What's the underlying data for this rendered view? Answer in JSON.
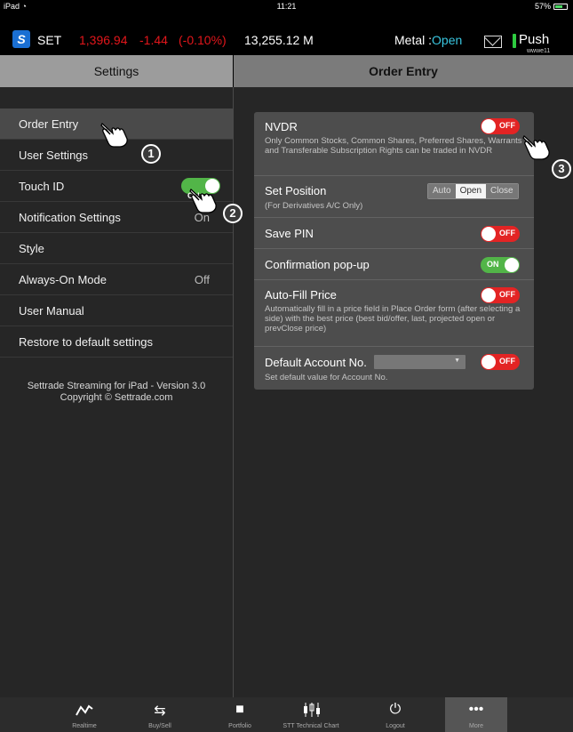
{
  "status": {
    "device": "iPad",
    "time": "11:21",
    "battery": "57%"
  },
  "ticker": {
    "index_name": "SET",
    "index_value": "1,396.94",
    "change": "-1.44",
    "change_pct": "(-0.10%)",
    "volume": "13,255.12 M",
    "market_label": "Metal :",
    "market_status": "Open",
    "push_label": "Push",
    "push_user": "wwwe11",
    "colors": {
      "negative": "#e3161b",
      "open": "#39c6e0"
    }
  },
  "headers": {
    "left": "Settings",
    "right": "Order Entry"
  },
  "sidebar": {
    "items": [
      {
        "label": "Order Entry",
        "value": ""
      },
      {
        "label": "User Settings",
        "value": ""
      },
      {
        "label": "Touch ID",
        "value": ""
      },
      {
        "label": "Notification Settings",
        "value": "On"
      },
      {
        "label": "Style",
        "value": ""
      },
      {
        "label": "Always-On Mode",
        "value": "Off"
      },
      {
        "label": "User Manual",
        "value": ""
      },
      {
        "label": "Restore to default settings",
        "value": ""
      }
    ],
    "touch_id_toggle": "ON",
    "version_line1": "Settrade Streaming for iPad - Version 3.0",
    "version_line2": "Copyright © Settrade.com"
  },
  "order_entry": {
    "nvdr": {
      "title": "NVDR",
      "desc": "Only Common Stocks, Common Shares, Preferred Shares, Warrants and Transferable Subscription Rights can be traded in NVDR",
      "toggle": "OFF"
    },
    "set_position": {
      "title": "Set Position",
      "desc": "(For Derivatives A/C Only)",
      "options": [
        "Auto",
        "Open",
        "Close"
      ],
      "selected": "Open"
    },
    "save_pin": {
      "title": "Save PIN",
      "toggle": "OFF"
    },
    "confirmation": {
      "title": "Confirmation pop-up",
      "toggle": "ON"
    },
    "auto_fill": {
      "title": "Auto-Fill Price",
      "desc": "Automatically fill in a price field in Place Order form (after selecting a side) with the best price (best bid/offer, last, projected open or prevClose price)",
      "toggle": "OFF"
    },
    "default_account": {
      "title": "Default Account No.",
      "desc": "Set default value for Account No.",
      "dropdown_value": "",
      "toggle": "OFF"
    }
  },
  "callouts": [
    "1",
    "2",
    "3"
  ],
  "tabs": [
    {
      "label": "Realtime",
      "icon": "realtime-chart-icon"
    },
    {
      "label": "Buy/Sell",
      "icon": "buy-sell-arrows-icon"
    },
    {
      "label": "Portfolio",
      "icon": "folder-icon"
    },
    {
      "label": "STT Technical Chart",
      "icon": "candlestick-icon"
    },
    {
      "label": "Logout",
      "icon": "power-icon"
    },
    {
      "label": "More",
      "icon": "more-dots-icon"
    }
  ],
  "active_tab": "More"
}
